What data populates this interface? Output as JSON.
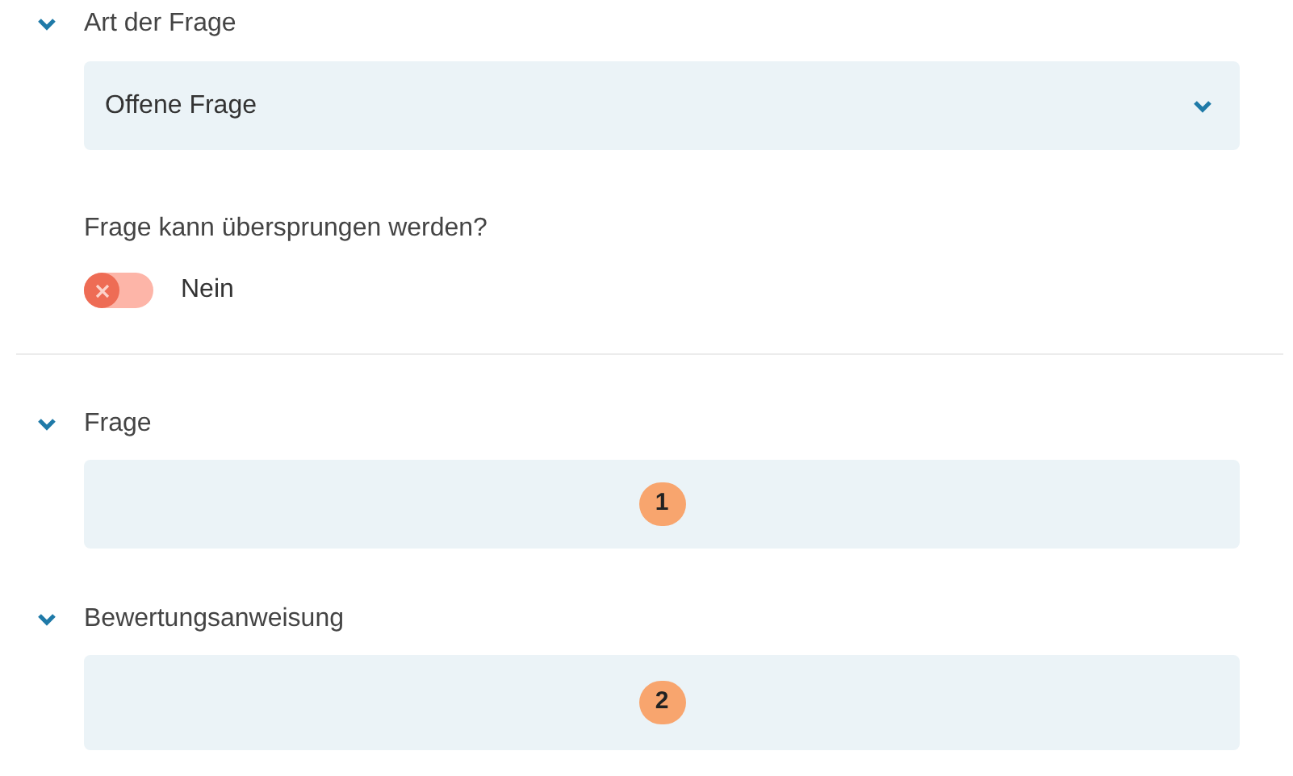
{
  "sections": [
    {
      "title": "Art der Frage",
      "expanded": true,
      "select": {
        "value": "Offene Frage"
      },
      "toggle": {
        "label": "Frage kann übersprungen werden?",
        "on": false,
        "state_text": "Nein"
      }
    },
    {
      "title": "Frage",
      "expanded": true,
      "field": {
        "badge": "1"
      }
    },
    {
      "title": "Bewertungsanweisung",
      "expanded": true,
      "field": {
        "badge": "2"
      }
    }
  ]
}
